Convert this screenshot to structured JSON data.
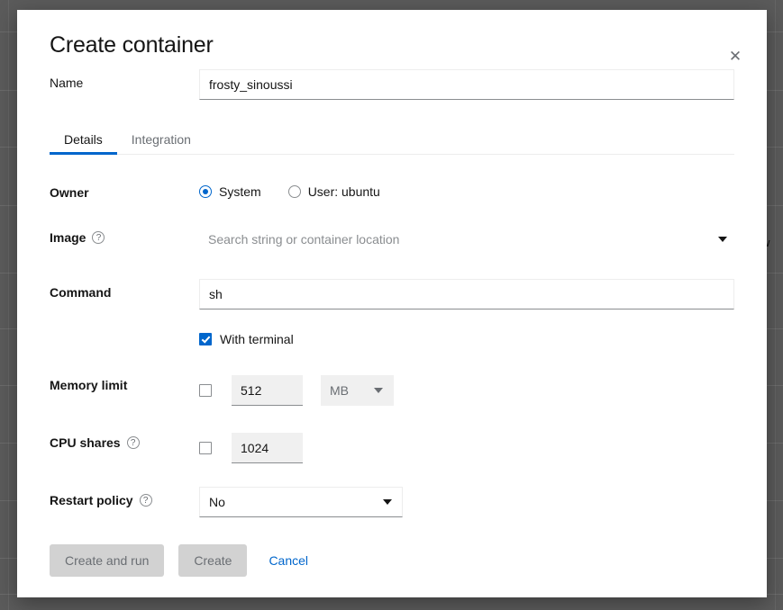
{
  "backdrop": {
    "ghost_text_right": "w"
  },
  "modal": {
    "title": "Create container",
    "close_label": "✕"
  },
  "name_field": {
    "label": "Name",
    "value": "frosty_sinoussi",
    "placeholder": ""
  },
  "tabs": [
    {
      "label": "Details",
      "active": true
    },
    {
      "label": "Integration",
      "active": false
    }
  ],
  "owner": {
    "label": "Owner",
    "options": [
      {
        "label": "System",
        "selected": true
      },
      {
        "label": "User: ubuntu",
        "selected": false
      }
    ]
  },
  "image": {
    "label": "Image",
    "help_glyph": "?",
    "value": "",
    "placeholder": "Search string or container location"
  },
  "command": {
    "label": "Command",
    "value": "sh",
    "placeholder": ""
  },
  "with_terminal": {
    "label": "With terminal",
    "checked": true
  },
  "memory_limit": {
    "label": "Memory limit",
    "checked": false,
    "value": "512",
    "unit": "MB"
  },
  "cpu_shares": {
    "label": "CPU shares",
    "help_glyph": "?",
    "checked": false,
    "value": "1024"
  },
  "restart_policy": {
    "label": "Restart policy",
    "help_glyph": "?",
    "value": "No"
  },
  "footer": {
    "create_and_run_label": "Create and run",
    "create_label": "Create",
    "cancel_label": "Cancel"
  },
  "colors": {
    "accent": "#0066cc",
    "text": "#151515",
    "muted": "#6a6e73",
    "border": "#8a8d90",
    "disabled_bg": "#d2d2d2",
    "field_disabled_bg": "#f0f0f0",
    "backdrop": "#5b5b5b"
  }
}
